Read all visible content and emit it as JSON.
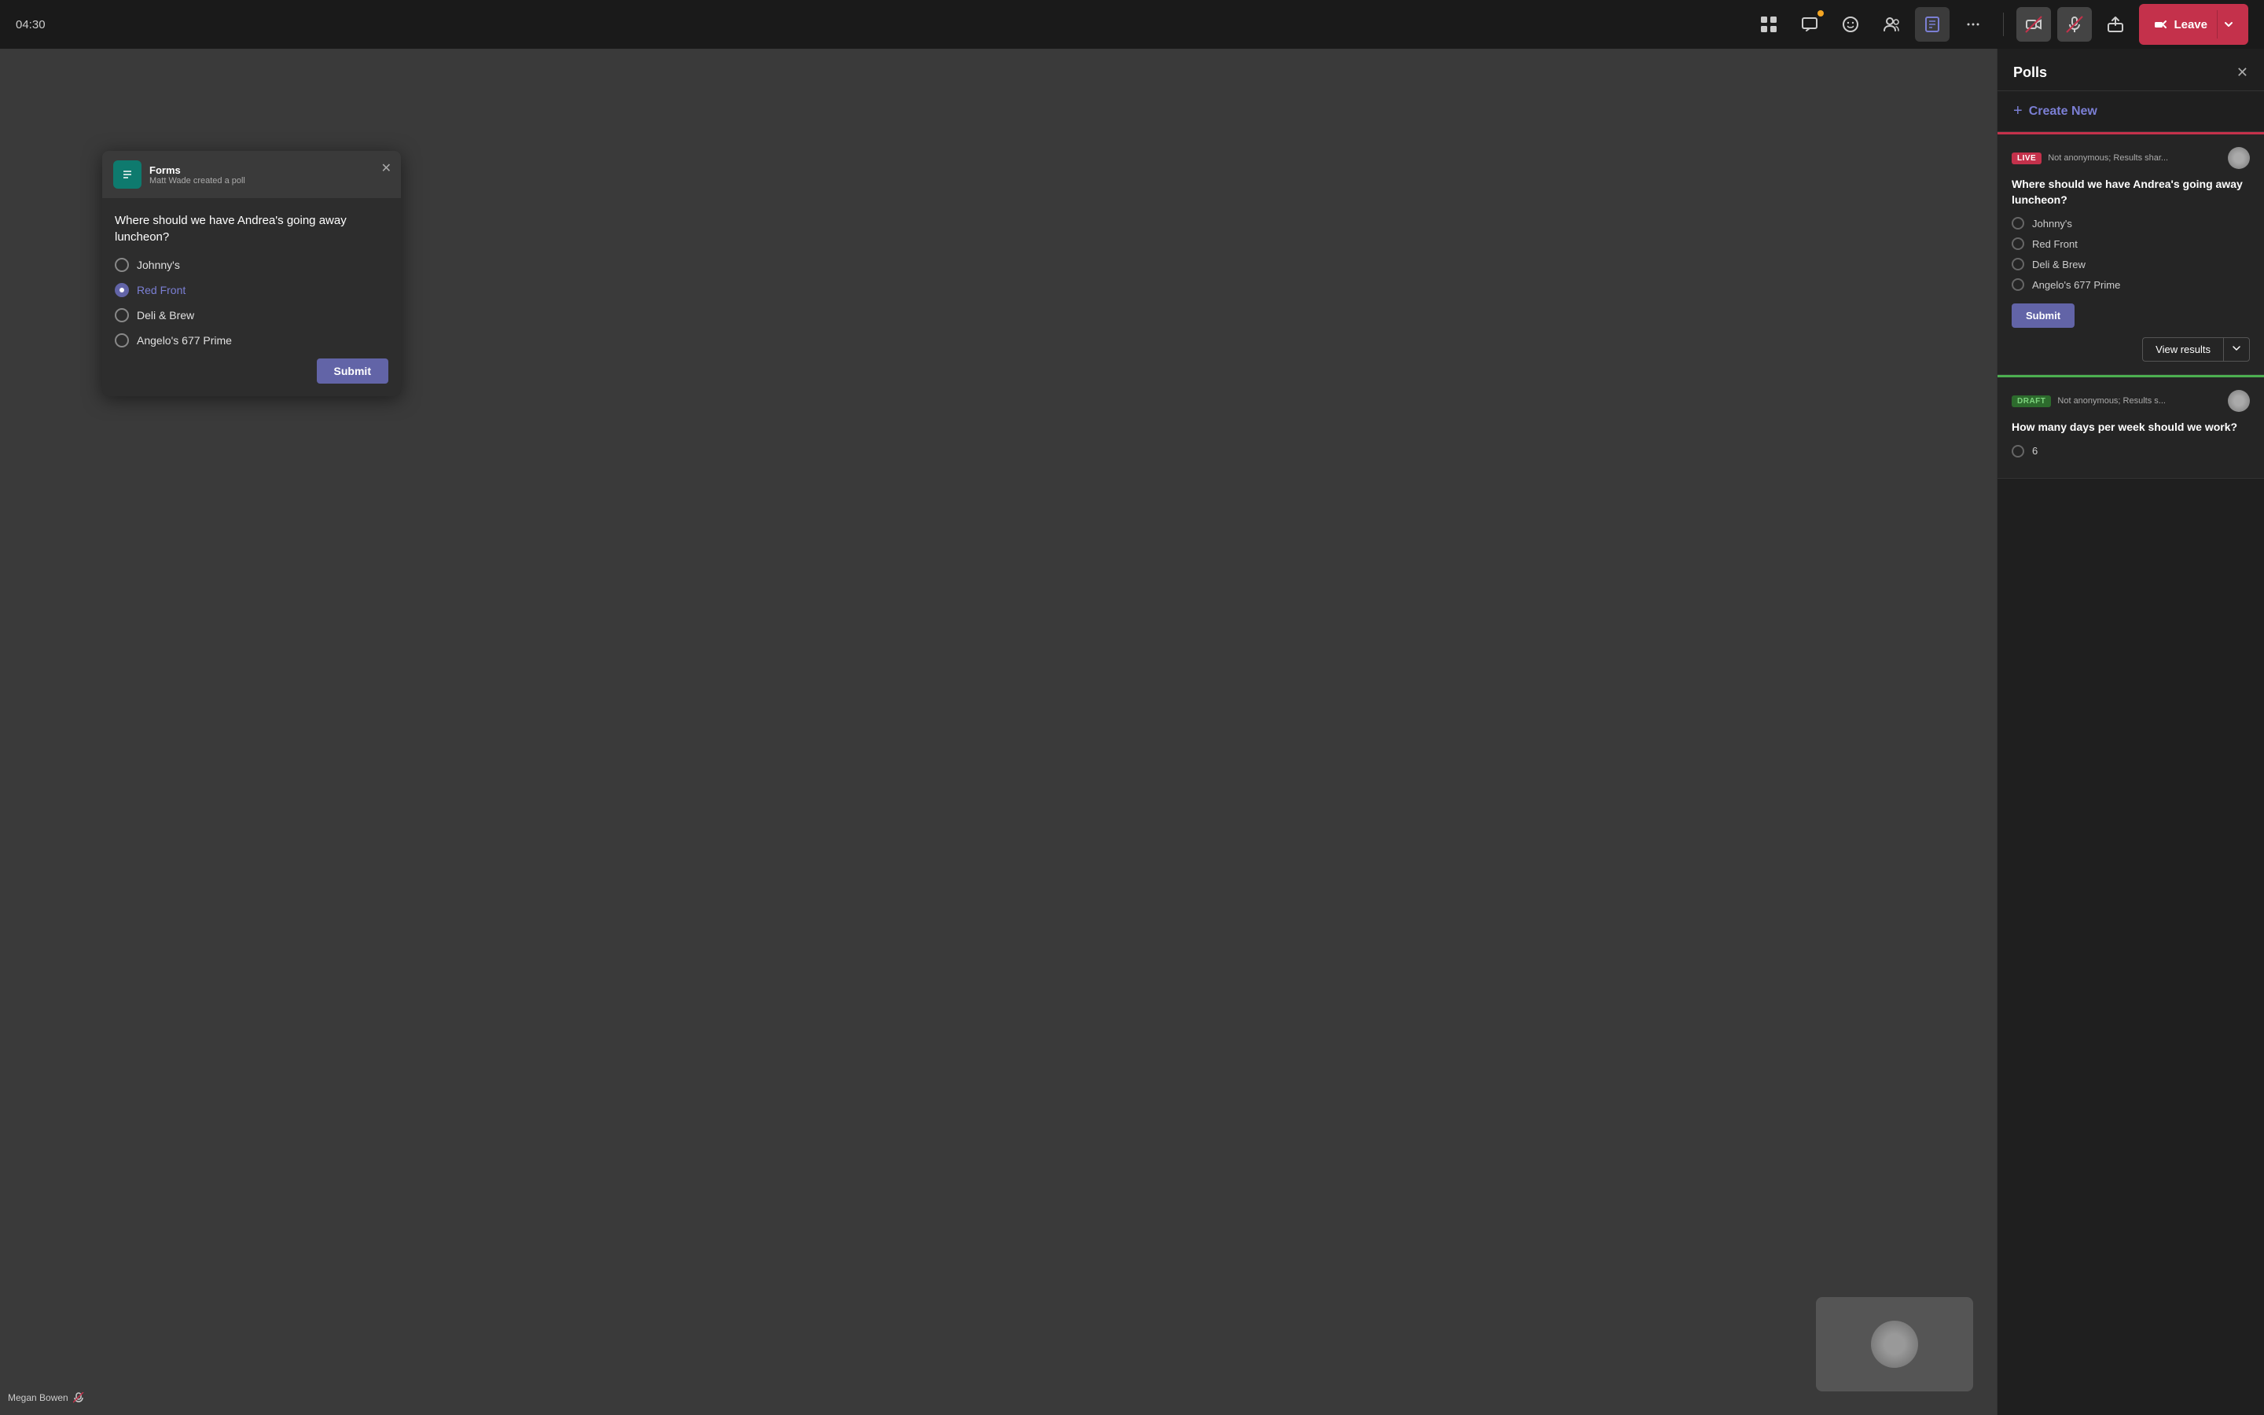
{
  "topbar": {
    "timer": "04:30",
    "leave_label": "Leave",
    "icons": {
      "apps": "⊞",
      "chat": "💬",
      "emoji": "😊",
      "people": "👥",
      "forms": "📋",
      "more": "•••",
      "video_off": "📷",
      "mic_off": "🎤",
      "share": "⬆",
      "call_end": "📞"
    }
  },
  "poll_popup": {
    "title": "Forms",
    "subtitle": "Matt Wade created a poll",
    "question": "Where should we have Andrea's going away luncheon?",
    "options": [
      {
        "label": "Johnny's",
        "selected": false
      },
      {
        "label": "Red Front",
        "selected": true
      },
      {
        "label": "Deli & Brew",
        "selected": false
      },
      {
        "label": "Angelo's 677 Prime",
        "selected": false
      }
    ],
    "submit_label": "Submit"
  },
  "panel": {
    "title": "Polls",
    "create_new_label": "Create New",
    "polls": [
      {
        "status": "LIVE",
        "meta": "Not anonymous; Results shar...",
        "question": "Where should we have Andrea's going away luncheon?",
        "options": [
          {
            "label": "Johnny's"
          },
          {
            "label": "Red Front"
          },
          {
            "label": "Deli & Brew"
          },
          {
            "label": "Angelo's 677 Prime"
          }
        ],
        "submit_label": "Submit",
        "view_results_label": "View results"
      },
      {
        "status": "DRAFT",
        "meta": "Not anonymous; Results s...",
        "question": "How many days per week should we work?",
        "options": [
          {
            "label": "6"
          }
        ]
      }
    ]
  },
  "name_label": "Megan Bowen"
}
